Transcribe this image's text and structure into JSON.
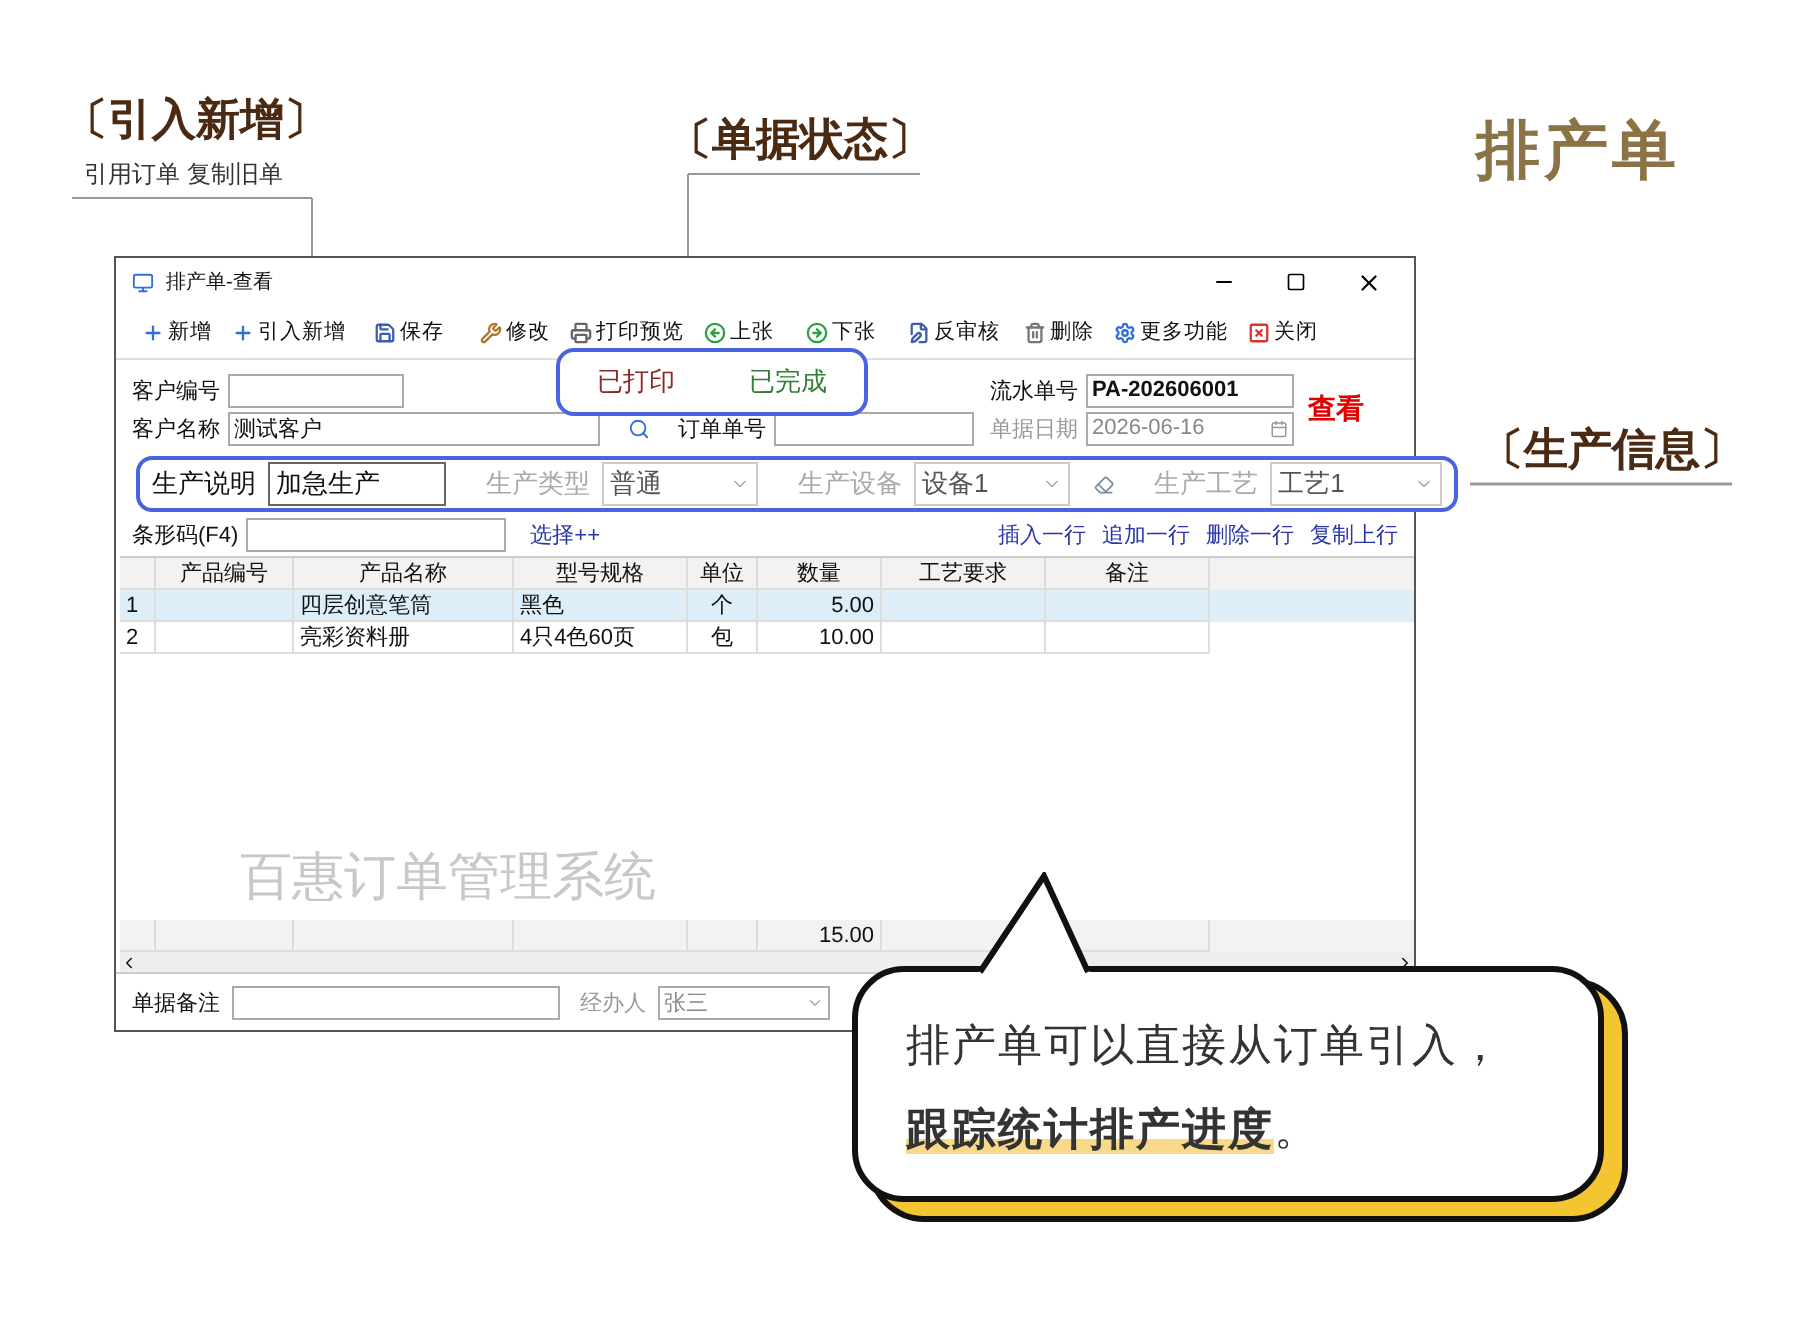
{
  "page_title": "排产单",
  "callout_import": {
    "title": "〔引入新增〕",
    "subtitle": "引用订单 复制旧单"
  },
  "callout_status": {
    "title": "〔单据状态〕"
  },
  "callout_production": {
    "title": "〔生产信息〕"
  },
  "window": {
    "title": "排产单-查看"
  },
  "toolbar": [
    {
      "label": "新增"
    },
    {
      "label": "引入新增"
    },
    {
      "label": "保存"
    },
    {
      "label": "修改"
    },
    {
      "label": "打印预览"
    },
    {
      "label": "上张"
    },
    {
      "label": "下张"
    },
    {
      "label": "反审核"
    },
    {
      "label": "删除"
    },
    {
      "label": "更多功能"
    },
    {
      "label": "关闭"
    }
  ],
  "status_badges": [
    {
      "label": "已打印",
      "color": "#8b2a2a"
    },
    {
      "label": "已完成",
      "color": "#2e7d32"
    }
  ],
  "header_fields": {
    "customer_code": {
      "label": "客户编号"
    },
    "customer_name": {
      "label": "客户名称",
      "value": "测试客户"
    },
    "order_no": {
      "label": "订单单号"
    },
    "serial_no": {
      "label": "流水单号",
      "value": "PA-202606001"
    },
    "date": {
      "label": "单据日期",
      "value": "2026-06-16",
      "disabled": true
    }
  },
  "view_mode": "查看",
  "production": [
    {
      "kind": "input",
      "label": "生产说明",
      "value": "加急生产",
      "disabled": false
    },
    {
      "kind": "select",
      "label": "生产类型",
      "value": "普通",
      "disabled": true
    },
    {
      "kind": "select",
      "label": "生产设备",
      "value": "设备1",
      "disabled": true
    },
    {
      "kind": "select",
      "label": "生产工艺",
      "value": "工艺1",
      "disabled": true
    }
  ],
  "barcode": {
    "label": "条形码(F4)"
  },
  "select_link": "选择++",
  "row_actions": [
    "插入一行",
    "追加一行",
    "删除一行",
    "复制上行"
  ],
  "table": {
    "columns": [
      "产品编号",
      "产品名称",
      "型号规格",
      "单位",
      "数量",
      "工艺要求",
      "备注"
    ],
    "rows": [
      {
        "row_number": "1",
        "name": "四层创意笔筒",
        "spec": "黑色",
        "unit": "个",
        "quantity": "5.00",
        "selected": true
      },
      {
        "row_number": "2",
        "name": "亮彩资料册",
        "spec": "4只4色60页",
        "unit": "包",
        "quantity": "10.00",
        "selected": false
      }
    ],
    "background_text": "百惠订单管理系统",
    "total_quantity": "15.00"
  },
  "footer": {
    "remark": {
      "label": "单据备注"
    },
    "handler": {
      "label": "经办人",
      "value": "张三"
    }
  },
  "bubble": {
    "lines": [
      "排产单可以直接从订单引入，",
      "**跟踪统计排产进度**。"
    ]
  }
}
